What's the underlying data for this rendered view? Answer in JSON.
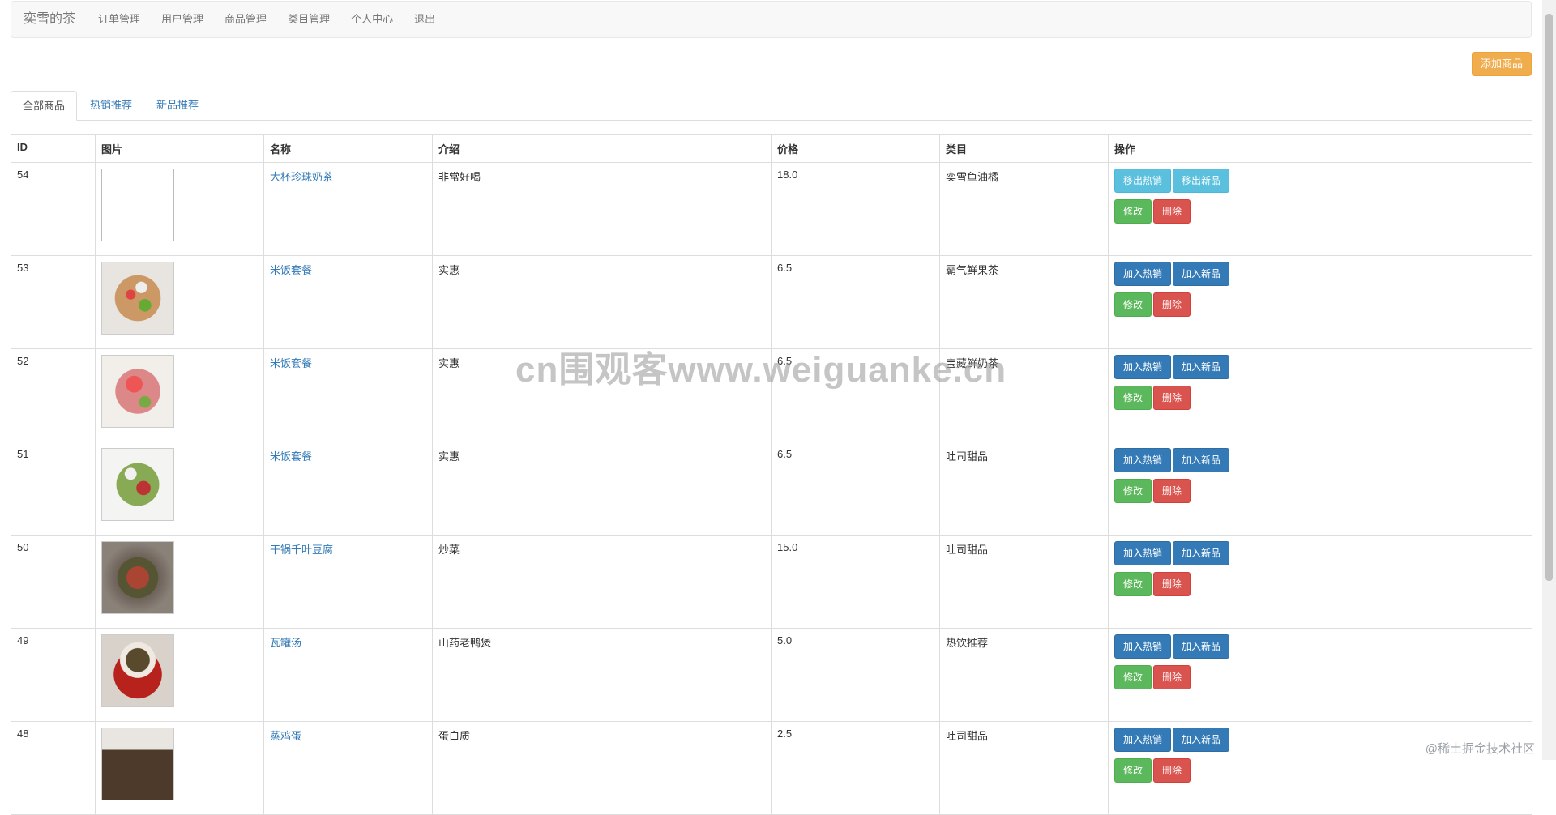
{
  "navbar": {
    "brand": "奕雪的茶",
    "items": [
      "订单管理",
      "用户管理",
      "商品管理",
      "类目管理",
      "个人中心",
      "退出"
    ]
  },
  "add_button": "添加商品",
  "tabs": [
    "全部商品",
    "热销推荐",
    "新品推荐"
  ],
  "table": {
    "headers": [
      "ID",
      "图片",
      "名称",
      "介绍",
      "价格",
      "类目",
      "操作"
    ],
    "rows": [
      {
        "id": "54",
        "name": "大杯珍珠奶茶",
        "intro": "非常好喝",
        "price": "18.0",
        "category": "奕雪鱼油橘",
        "hot_label": "移出热销",
        "new_label": "移出新品",
        "edit_label": "修改",
        "delete_label": "删除"
      },
      {
        "id": "53",
        "name": "米饭套餐",
        "intro": "实惠",
        "price": "6.5",
        "category": "霸气鲜果茶",
        "hot_label": "加入热销",
        "new_label": "加入新品",
        "edit_label": "修改",
        "delete_label": "删除"
      },
      {
        "id": "52",
        "name": "米饭套餐",
        "intro": "实惠",
        "price": "6.5",
        "category": "宝藏鲜奶茶",
        "hot_label": "加入热销",
        "new_label": "加入新品",
        "edit_label": "修改",
        "delete_label": "删除"
      },
      {
        "id": "51",
        "name": "米饭套餐",
        "intro": "实惠",
        "price": "6.5",
        "category": "吐司甜品",
        "hot_label": "加入热销",
        "new_label": "加入新品",
        "edit_label": "修改",
        "delete_label": "删除"
      },
      {
        "id": "50",
        "name": "干锅千叶豆腐",
        "intro": "炒菜",
        "price": "15.0",
        "category": "吐司甜品",
        "hot_label": "加入热销",
        "new_label": "加入新品",
        "edit_label": "修改",
        "delete_label": "删除"
      },
      {
        "id": "49",
        "name": "瓦罐汤",
        "intro": "山药老鸭煲",
        "price": "5.0",
        "category": "热饮推荐",
        "hot_label": "加入热销",
        "new_label": "加入新品",
        "edit_label": "修改",
        "delete_label": "删除"
      },
      {
        "id": "48",
        "name": "蒸鸡蛋",
        "intro": "蛋白质",
        "price": "2.5",
        "category": "吐司甜品",
        "hot_label": "加入热销",
        "new_label": "加入新品",
        "edit_label": "修改",
        "delete_label": "删除"
      }
    ]
  },
  "watermark": "cn围观客www.weiguanke.cn",
  "corner_mark": "@稀土掘金技术社区"
}
